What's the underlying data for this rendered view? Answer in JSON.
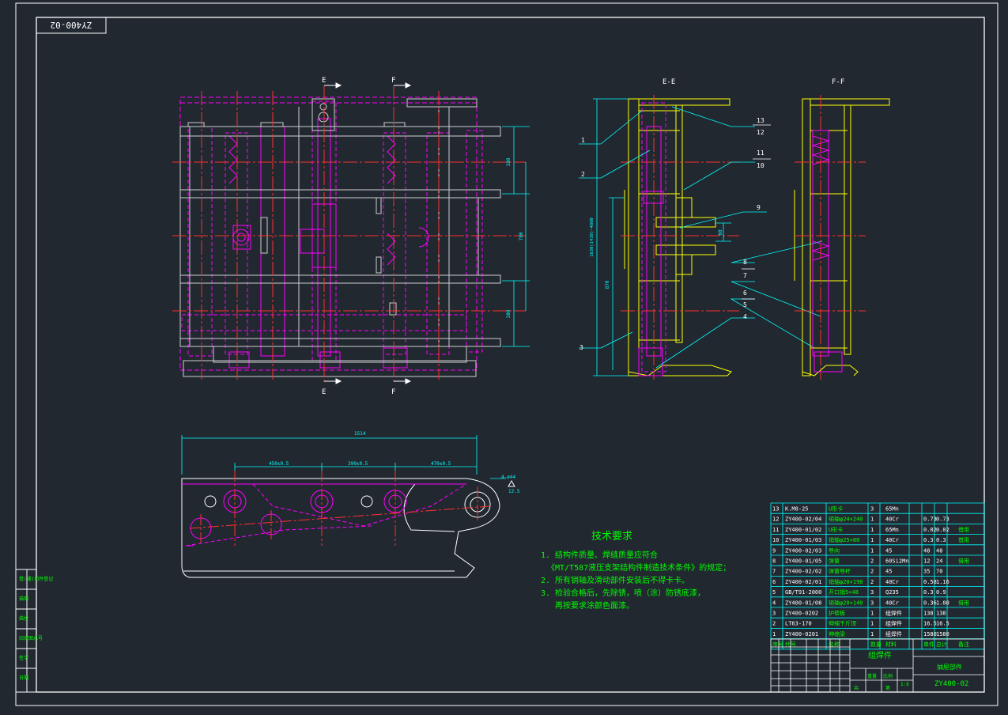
{
  "drawing": {
    "corner_label": "ZY400-02",
    "drawing_number": "ZY400-02",
    "drawing_name_cn": "组焊件",
    "drawing_subname_cn": "抽屉部件"
  },
  "views": {
    "section_e": "E-E",
    "section_f": "F-F",
    "cut_e": "E",
    "cut_f": "F"
  },
  "dimensions": {
    "plan_top": "380",
    "plan_mid": "780",
    "plan_bottom": "380",
    "section_height": "1630(1430)~4800",
    "section_lower": "870",
    "section_gap": "60",
    "elev_total": "1514",
    "elev_seg1": "450±0.5",
    "elev_seg2": "390±0.5",
    "elev_seg3": "470±0.5",
    "elev_hole": "4-ø44",
    "elev_hole_r": "12.5"
  },
  "leaders": {
    "left_e": [
      "1",
      "2",
      "3"
    ],
    "right_e": [
      "13",
      "12",
      "11",
      "10",
      "9"
    ],
    "right_f": [
      "8",
      "7",
      "6",
      "5",
      "4"
    ]
  },
  "tech_requirements": {
    "title": "技术要求",
    "lines": [
      "1. 结构件质量、焊缝质量应符合",
      "《MT/T587液压支架结构件制造技术条件》的规定；",
      "2. 所有销轴及滑动部件安装后不得卡卡。",
      "3. 检验合格后，先除锈，喷（涂）防锈底漆，",
      "   再按要求涂颜色面漆。"
    ]
  },
  "bom": {
    "headers": [
      "序号",
      "代号",
      "名称",
      "数量",
      "材料",
      "单件",
      "总计",
      "备注"
    ],
    "rows": [
      [
        "13",
        "K.M8-25",
        "U形卡",
        "3",
        "65Mn",
        "",
        "",
        ""
      ],
      [
        "12",
        "ZY400-02/04",
        "销轴φ24×240",
        "1",
        "40Cr",
        "0.73",
        "0.73",
        ""
      ],
      [
        "11",
        "ZY400-01/02",
        "U形卡",
        "1",
        "65Mn",
        "0.02",
        "0.02",
        "借用"
      ],
      [
        "10",
        "ZY400-01/03",
        "销轴φ25×80",
        "1",
        "40Cr",
        "0.3",
        "0.3",
        "借用"
      ],
      [
        "9",
        "ZY400-02/03",
        "导向",
        "1",
        "45",
        "48",
        "48",
        ""
      ],
      [
        "8",
        "ZY400-01/05",
        "弹簧",
        "2",
        "60Si2Mn",
        "12",
        "24",
        "借用"
      ],
      [
        "7",
        "ZY400-02/02",
        "弹簧导杆",
        "2",
        "45",
        "35",
        "70",
        ""
      ],
      [
        "6",
        "ZY400-02/01",
        "销轴φ20×190",
        "2",
        "40Cr",
        "0.58",
        "1.16",
        ""
      ],
      [
        "5",
        "GB/T91-2000",
        "开口销5×48",
        "3",
        "Q235",
        "0.3",
        "0.9",
        ""
      ],
      [
        "4",
        "ZY400-01/08",
        "销轴φ20×140",
        "3",
        "40Cr",
        "0.36",
        "1.08",
        "借用"
      ],
      [
        "3",
        "ZY400-0202",
        "护帮板",
        "1",
        "组焊件",
        "138",
        "138",
        ""
      ],
      [
        "2",
        "LT63-170",
        "伸缩千斤顶",
        "1",
        "组焊件",
        "16.5",
        "16.5",
        ""
      ],
      [
        "1",
        "ZY400-0201",
        "伸缩梁",
        "1",
        "组焊件",
        "1580",
        "1580",
        ""
      ]
    ]
  },
  "title_block": {
    "scale_label": "比例",
    "scale": "1:6",
    "weight_label": "重量",
    "sheet_label": "共",
    "page_label": "第"
  },
  "side_strip": [
    "借(通)用件登记",
    "描图",
    "描校",
    "旧底图总号",
    "签字",
    "日期"
  ],
  "colors": {
    "background": "#212830",
    "frame": "#ffffff",
    "outline": "#ffff00",
    "hidden": "#ff00ff",
    "center": "#ff3030",
    "dimension": "#00ffff",
    "text": "#00ff00"
  }
}
